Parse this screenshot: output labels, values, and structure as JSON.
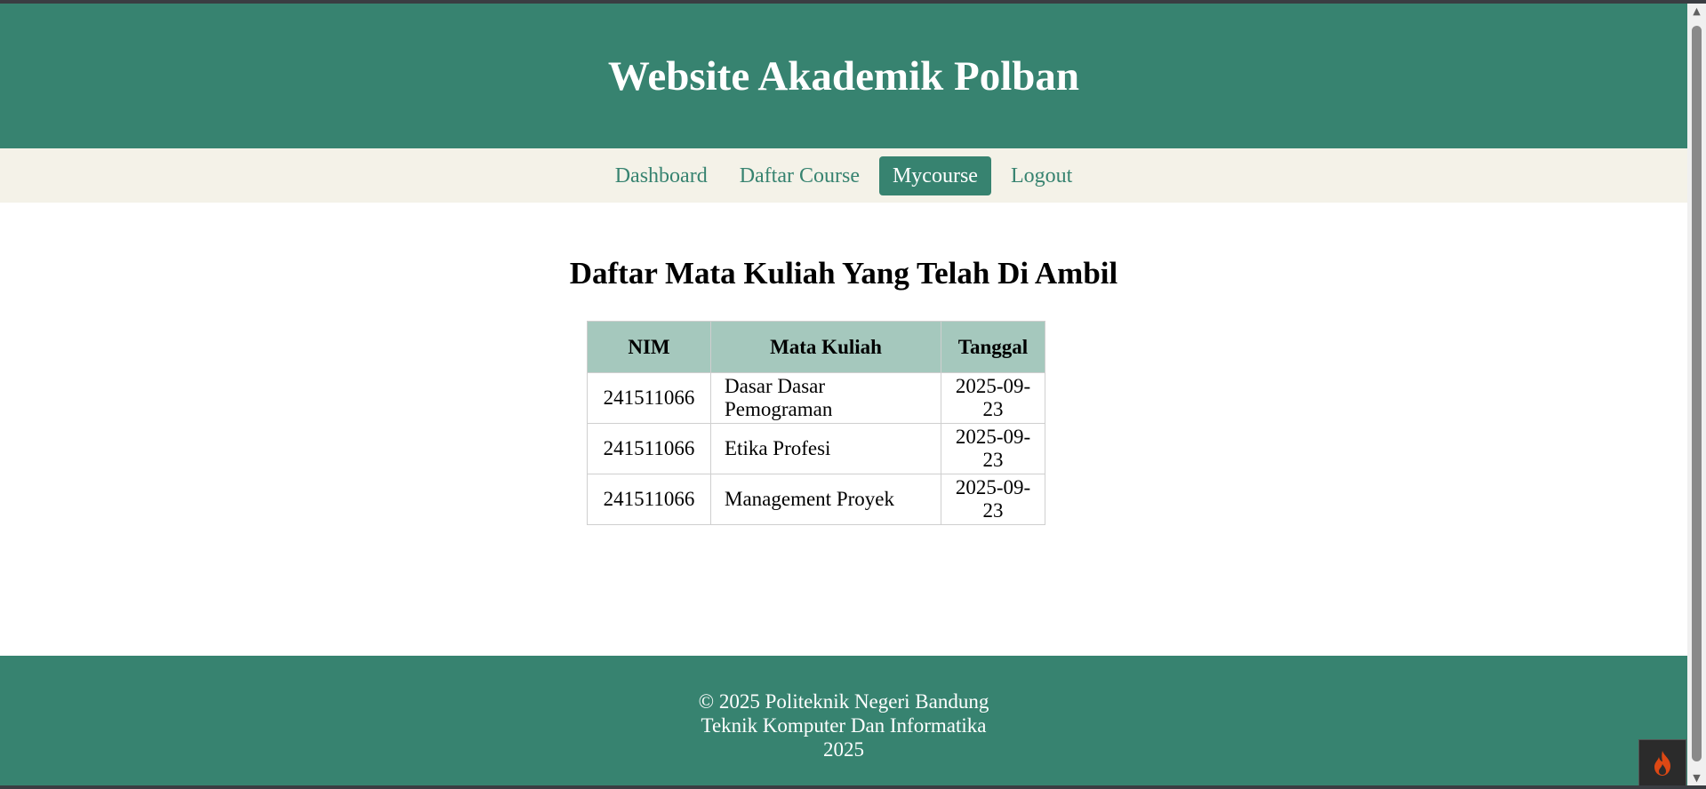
{
  "header": {
    "title": "Website Akademik Polban"
  },
  "nav": {
    "items": [
      {
        "label": "Dashboard"
      },
      {
        "label": "Daftar Course"
      },
      {
        "label": "Mycourse",
        "active": true
      },
      {
        "label": "Logout"
      }
    ]
  },
  "main": {
    "title": "Daftar Mata Kuliah Yang Telah Di Ambil",
    "table": {
      "headers": [
        "NIM",
        "Mata Kuliah",
        "Tanggal"
      ],
      "rows": [
        [
          "241511066",
          "Dasar Dasar Pemograman",
          "2025-09-23"
        ],
        [
          "241511066",
          "Etika Profesi",
          "2025-09-23"
        ],
        [
          "241511066",
          "Management Proyek",
          "2025-09-23"
        ]
      ]
    }
  },
  "footer": {
    "line1": "© 2025 Politeknik Negeri Bandung",
    "line2": "Teknik Komputer Dan Informatika",
    "line3": "2025"
  },
  "colors": {
    "primary": "#378370",
    "nav_bg": "#f4f2e8",
    "table_header_bg": "#a5c8bd"
  },
  "icons": {
    "debug_toolbar": "flame-icon"
  }
}
